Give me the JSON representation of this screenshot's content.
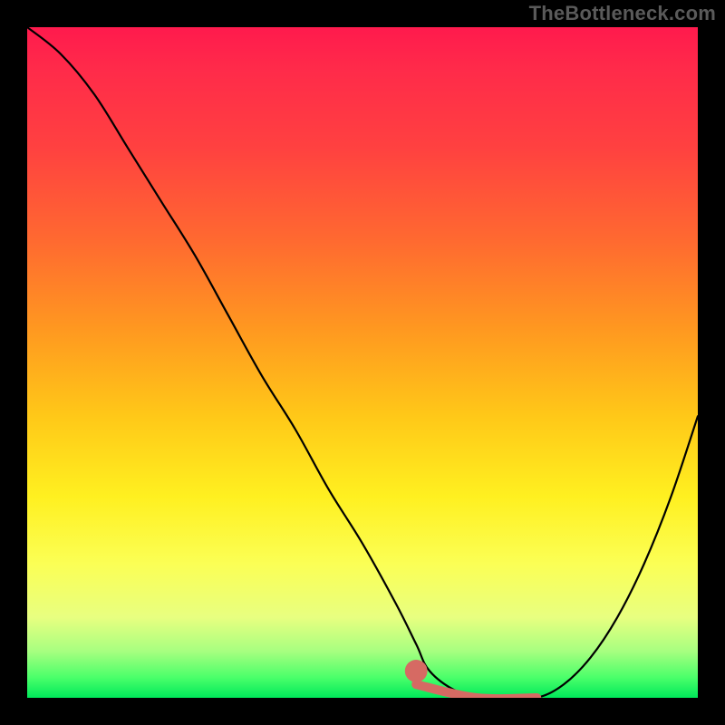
{
  "watermark": "TheBottleneck.com",
  "chart_data": {
    "type": "line",
    "title": "",
    "xlabel": "",
    "ylabel": "",
    "xlim": [
      0,
      100
    ],
    "ylim": [
      0,
      100
    ],
    "gradient_stops": [
      {
        "pos": 0,
        "color": "#ff1a4d"
      },
      {
        "pos": 6,
        "color": "#ff2a4a"
      },
      {
        "pos": 18,
        "color": "#ff4140"
      },
      {
        "pos": 32,
        "color": "#ff6a30"
      },
      {
        "pos": 45,
        "color": "#ff9820"
      },
      {
        "pos": 58,
        "color": "#ffc818"
      },
      {
        "pos": 70,
        "color": "#fff020"
      },
      {
        "pos": 80,
        "color": "#fbff55"
      },
      {
        "pos": 88,
        "color": "#e8ff80"
      },
      {
        "pos": 93,
        "color": "#a8ff80"
      },
      {
        "pos": 97,
        "color": "#4aff6a"
      },
      {
        "pos": 100,
        "color": "#00e85a"
      }
    ],
    "series": [
      {
        "name": "bottleneck-curve",
        "x": [
          0,
          5,
          10,
          15,
          20,
          25,
          30,
          35,
          40,
          45,
          50,
          55,
          58,
          60,
          64,
          68,
          72,
          76,
          80,
          84,
          88,
          92,
          96,
          100
        ],
        "y": [
          100,
          96,
          90,
          82,
          74,
          66,
          57,
          48,
          40,
          31,
          23,
          14,
          8,
          4,
          1,
          0,
          0,
          0,
          2,
          6,
          12,
          20,
          30,
          42
        ]
      }
    ],
    "highlight": {
      "name": "optimal-range",
      "color": "#d66a63",
      "x": [
        58,
        76
      ],
      "y": [
        2,
        0
      ]
    },
    "highlight_dot": {
      "x": 58,
      "y": 4,
      "r": 1,
      "color": "#d66a63"
    }
  }
}
